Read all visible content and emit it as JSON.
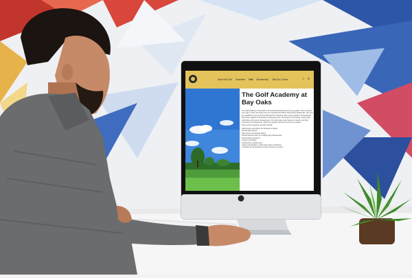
{
  "site": {
    "nav": [
      "About the Club",
      "Amenities",
      "Golf",
      "Membership",
      "Visit Our Course"
    ],
    "title": "The Golf Academy at Bay Oaks",
    "body": "Our Golf Academy is devoted to the personal development of every golfer. Come improve your play or learn the game from our experienced staff of PGA golf professionals. Our pros are available for group and private lessons including video swing analysis. Personalized instruction applies to all aspects of the game from short game to full swing, course play, club fitting and course management. Our golf lessons are based on results, and their curriculum are designed to maximize progress with each and every student.",
    "programs_intro": "Some of the programs we offer include:",
    "programs": [
      "Golf lessons and clinics for all levels of player",
      "Private golf lessons",
      "Short game and putting clinics",
      "Private lessons with our certified golf professionals",
      "Personalized programs",
      "Custom club fitting",
      "Introductory programming",
      "Latest technologies to help track swing mechanics",
      "Complete set of analytics to help improve your game"
    ]
  },
  "colors": {
    "header_gold": "#e3c35a",
    "wall_navy": "#2d56a8",
    "wall_red": "#c2352d",
    "wall_light_blue": "#bfd5f0",
    "shirt_gray": "#6a6c6e",
    "plant_green": "#3e8a2a"
  },
  "icons": {
    "logo": "golf-club-logo-icon",
    "menu": "hamburger-menu-icon",
    "search": "search-icon",
    "apple": "apple-logo-icon"
  }
}
